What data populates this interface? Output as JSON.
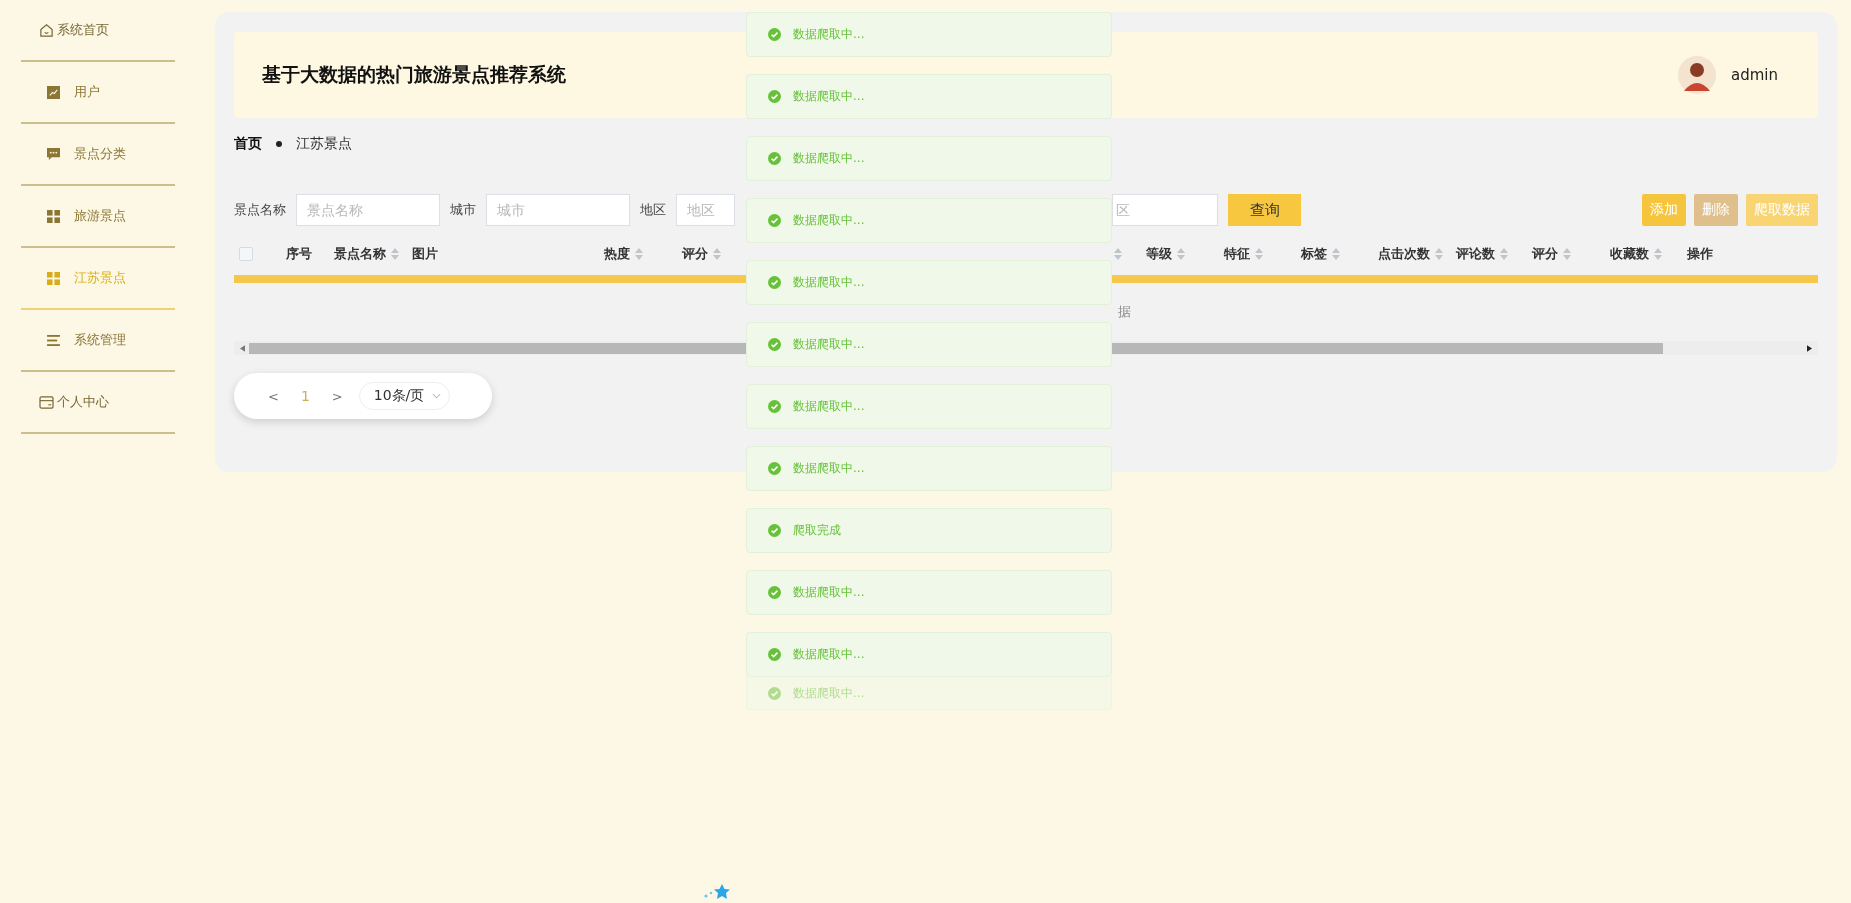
{
  "sidebar": {
    "items": [
      {
        "label": "系统首页",
        "selected": false
      },
      {
        "label": "用户",
        "selected": false
      },
      {
        "label": "景点分类",
        "selected": false
      },
      {
        "label": "旅游景点",
        "selected": false
      },
      {
        "label": "江苏景点",
        "selected": true
      },
      {
        "label": "系统管理",
        "selected": false
      },
      {
        "label": "个人中心",
        "selected": false
      }
    ]
  },
  "header": {
    "title": "基于大数据的热门旅游景点推荐系统",
    "user": "admin"
  },
  "breadcrumb": [
    "首页",
    "江苏景点"
  ],
  "search": {
    "fields": [
      {
        "label": "景点名称",
        "placeholder": "景点名称"
      },
      {
        "label": "城市",
        "placeholder": "城市"
      },
      {
        "label": "地区",
        "placeholder": "地区"
      },
      {
        "placeholder": "区"
      }
    ],
    "button": "查询"
  },
  "actions": [
    {
      "label": "添加",
      "disabled": false
    },
    {
      "label": "删除",
      "disabled": true
    },
    {
      "label": "爬取数据",
      "disabled": false
    }
  ],
  "table": {
    "select_all": {
      "checked": false
    },
    "columns": [
      {
        "label": "序号",
        "sortable": false
      },
      {
        "label": "景点名称",
        "sortable": true
      },
      {
        "label": "图片",
        "sortable": false
      },
      {
        "label": "热度",
        "sortable": true
      },
      {
        "label": "评分",
        "sortable": true
      },
      {
        "sortable": true
      },
      {
        "label": "等级",
        "sortable": true
      },
      {
        "label": "特征",
        "sortable": true
      },
      {
        "label": "标签",
        "sortable": true
      },
      {
        "label": "点击次数",
        "sortable": true
      },
      {
        "label": "评论数",
        "sortable": true
      },
      {
        "label": "评分",
        "sortable": true
      },
      {
        "label": "收藏数",
        "sortable": true
      },
      {
        "label": "操作",
        "sortable": false
      }
    ],
    "empty_text": "据"
  },
  "pagination": {
    "prev": "<",
    "pages": [
      {
        "label": "1",
        "selected": true
      }
    ],
    "next": ">",
    "page_size": "10条/页"
  },
  "toasts": [
    {
      "text": "数据爬取中...",
      "faded": false
    },
    {
      "text": "数据爬取中...",
      "faded": false
    },
    {
      "text": "数据爬取中...",
      "faded": false
    },
    {
      "text": "数据爬取中...",
      "faded": false
    },
    {
      "text": "数据爬取中...",
      "faded": false
    },
    {
      "text": "数据爬取中...",
      "faded": false
    },
    {
      "text": "数据爬取中...",
      "faded": false
    },
    {
      "text": "数据爬取中...",
      "faded": false
    },
    {
      "text": "爬取完成",
      "faded": false
    },
    {
      "text": "数据爬取中...",
      "faded": false
    },
    {
      "text": "数据爬取中...",
      "faded": false
    },
    {
      "text": "数据爬取中...",
      "faded": true
    }
  ]
}
